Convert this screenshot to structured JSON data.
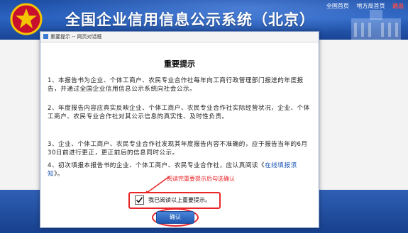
{
  "header": {
    "title": "全国企业信用信息公示系统（北京）",
    "links": {
      "national_home": "全国首页",
      "local_home": "地方局首页",
      "exit": "退出"
    }
  },
  "dialog": {
    "window_title": "重要提示 -- 网页对话框",
    "heading": "重要提示",
    "paragraphs": {
      "p1": "1、本报告书为企业、个体工商户、农民专业合作社每年向工商行政管理部门报送的年度报告，并通过全国企业信用信息公示系统向社会公示。",
      "p2": "2、年度报告内容应真实反映企业、个体工商户、农民专业合作社实际经营状况，企业、个体工商户、农民专业合作社对其公示信息的真实性、及时性负责。",
      "p3": "3、企业、个体工商户、农民专业合作社发现其年度报告内容不准确的，应于报告当年的6月30日前进行更正，更正前后的信息同时公示。",
      "p4_before": "4、初次填报本报告书的企业、个体工商户、农民专业合作社，应认真阅读《",
      "p4_link": "在线填报须知",
      "p4_after": "》。"
    },
    "annotation": "阅读完重要提示后勾选确认",
    "consent_label": "我已阅读以上重要提示。",
    "confirm_button": "确认"
  },
  "colors": {
    "header_blue": "#2b63c0",
    "annotation_red": "#e8262a",
    "button_blue": "#2e6cc4"
  }
}
